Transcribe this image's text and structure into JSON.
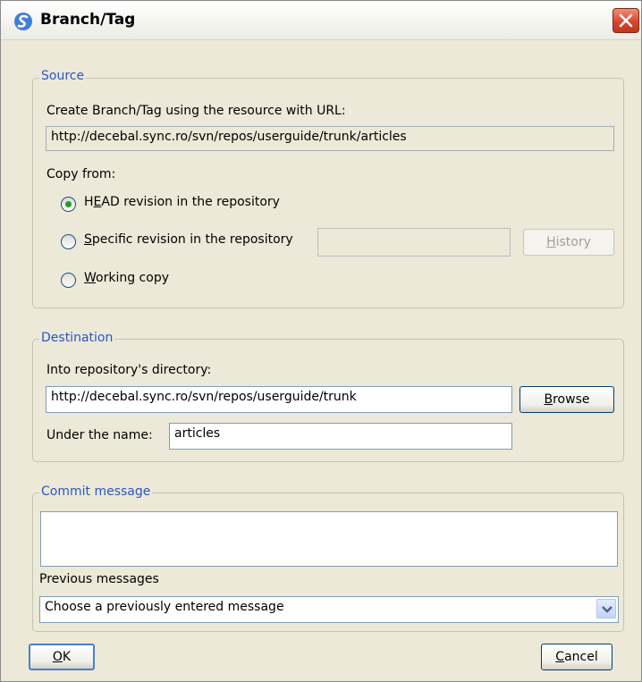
{
  "window": {
    "title": "Branch/Tag",
    "icon": "syncro-s-icon",
    "close_icon": "close-icon"
  },
  "source": {
    "group_label": "Source",
    "url_prompt": "Create Branch/Tag using the resource with URL:",
    "url_value": "http://decebal.sync.ro/svn/repos/userguide/trunk/articles",
    "copy_from_label": "Copy from:",
    "options": [
      {
        "label_pre": "H",
        "label_mnemonic": "E",
        "label_post": "AD revision in the repository",
        "checked": true
      },
      {
        "label_pre": "",
        "label_mnemonic": "S",
        "label_post": "pecific revision in the repository",
        "checked": false
      },
      {
        "label_pre": "",
        "label_mnemonic": "W",
        "label_post": "orking copy",
        "checked": false
      }
    ],
    "revision_value": "",
    "history_button": {
      "mnemonic": "H",
      "rest": "istory"
    }
  },
  "destination": {
    "group_label": "Destination",
    "dir_prompt": "Into repository's directory:",
    "dir_value": "http://decebal.sync.ro/svn/repos/userguide/trunk",
    "browse_button": {
      "mnemonic": "B",
      "rest": "rowse"
    },
    "name_label": "Under the name:",
    "name_value": "articles"
  },
  "commit": {
    "group_label": "Commit message",
    "message_value": "",
    "previous_label": "Previous messages",
    "previous_selected": "Choose a previously entered message"
  },
  "buttons": {
    "ok": {
      "mnemonic": "O",
      "rest": "K"
    },
    "cancel": {
      "mnemonic": "C",
      "rest": "ancel"
    }
  },
  "colors": {
    "group_label": "#2a56c6",
    "dialog_bg": "#ece9d8",
    "radio_dot": "#21a121",
    "close_red": "#d9462c"
  }
}
